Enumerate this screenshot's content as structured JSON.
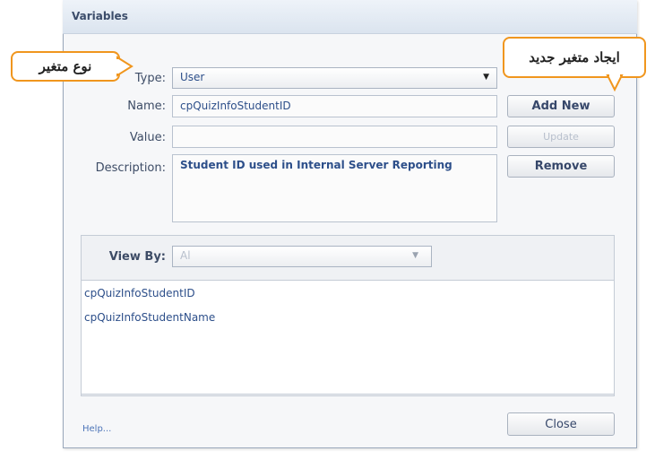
{
  "window": {
    "title": "Variables"
  },
  "form": {
    "type_label": "Type:",
    "type_value": "User",
    "name_label": "Name:",
    "name_value": "cpQuizInfoStudentID",
    "value_label": "Value:",
    "value_value": "",
    "description_label": "Description:",
    "description_value": "Student ID used in Internal Server Reporting"
  },
  "buttons": {
    "add_new": "Add New",
    "update": "Update",
    "remove": "Remove",
    "close": "Close"
  },
  "view": {
    "label": "View By:",
    "value": "Al"
  },
  "variables": [
    "cpQuizInfoStudentID",
    "cpQuizInfoStudentName"
  ],
  "footer": {
    "help": "Help..."
  },
  "callouts": {
    "type_note": "نوع متغير",
    "new_var_note": "ايجاد متغير جديد"
  },
  "colors": {
    "callout_border": "#f0961e",
    "dialog_bg": "#f6f7f9",
    "text_blue": "#2d4f8a"
  }
}
